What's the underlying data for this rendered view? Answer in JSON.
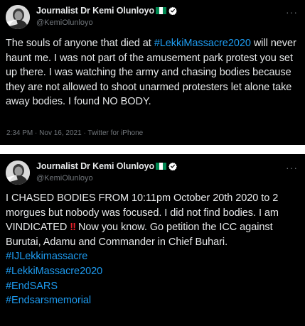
{
  "tweets": [
    {
      "author": {
        "name": "Journalist Dr Kemi Olunloyo",
        "handle": "@KemiOlunloyo",
        "avatar_icon": "avatar-photo-icon",
        "flag_icon": "nigeria-flag-icon",
        "verified_icon": "verified-badge-icon"
      },
      "more_label": "···",
      "text_before": "The souls of anyone that died at ",
      "hashtag": "#LekkiMassacre2020",
      "text_after": " will never haunt me. I was not part of the amusement park protest you set up there. I was watching the army and chasing bodies because they are not allowed to shoot unarmed protesters let alone take away bodies. I found NO BODY.",
      "time": "2:34 PM",
      "date": "Nov 16, 2021",
      "client": "Twitter for iPhone",
      "meta_separator": "·"
    },
    {
      "author": {
        "name": "Journalist Dr Kemi Olunloyo",
        "handle": "@KemiOlunloyo",
        "avatar_icon": "avatar-photo-icon",
        "flag_icon": "nigeria-flag-icon",
        "verified_icon": "verified-badge-icon"
      },
      "more_label": "···",
      "text_before": "I CHASED BODIES FROM 10:11pm October 20th 2020 to 2 morgues but nobody was focused. I did not find bodies. I am VINDICATED",
      "emoji": "‼",
      "text_after": " Now you know. Go petition the ICC against Burutai, Adamu and Commander in Chief Buhari.",
      "hashtags": [
        "#IJLekkimassacre",
        "#LekkiMassacre2020",
        "#EndSARS",
        "#Endsarsmemorial"
      ]
    }
  ],
  "colors": {
    "card_background": "#000000",
    "page_background": "#ffffff",
    "text": "#e7e9ea",
    "secondary_text": "#71767b",
    "link": "#1d9bf0",
    "verified": "#ffffff",
    "flag_green": "#008751",
    "flag_white": "#ffffff",
    "emoji_red": "#e8202a"
  }
}
